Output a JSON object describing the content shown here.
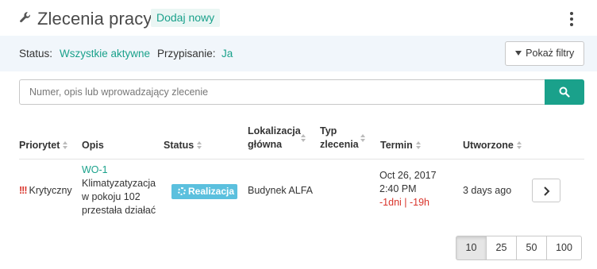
{
  "header": {
    "title": "Zlecenia pracy",
    "add_new_label": "Dodaj nowy",
    "menu_icon": "kebab-menu-icon",
    "title_icon": "wrench-icon"
  },
  "filters": {
    "status_label": "Status:",
    "status_value": "Wszystkie aktywne",
    "assignment_label": "Przypisanie:",
    "assignment_value": "Ja",
    "show_filters_label": "Pokaż filtry"
  },
  "search": {
    "placeholder": "Numer, opis lub wprowadzający zlecenie",
    "value": ""
  },
  "table": {
    "columns": [
      {
        "label": "Priorytet"
      },
      {
        "label": "Opis"
      },
      {
        "label": "Status"
      },
      {
        "label_line1": "Lokalizacja",
        "label_line2": "główna"
      },
      {
        "label_line1": "Typ",
        "label_line2": "zlecenia"
      },
      {
        "label": "Termin"
      },
      {
        "label": "Utworzone"
      }
    ],
    "rows": [
      {
        "priority_mark": "!!!",
        "priority": "Krytyczny",
        "wo_number": "WO-1",
        "description_lines": [
          "Klimatyzatyzacja",
          "w pokoju 102",
          "przestała działać"
        ],
        "status": "Realizacja",
        "location": "Budynek ALFA",
        "type": "",
        "due_date": "Oct 26, 2017",
        "due_time": "2:40 PM",
        "overdue": "-1dni | -19h",
        "created": "3 days ago"
      }
    ]
  },
  "pagination": {
    "sizes": [
      "10",
      "25",
      "50",
      "100"
    ],
    "active": "10"
  },
  "colors": {
    "accent": "#1aa18b",
    "status_badge": "#5bc0de",
    "danger": "#d9342b",
    "filter_bar_bg": "#f1f6fb"
  }
}
